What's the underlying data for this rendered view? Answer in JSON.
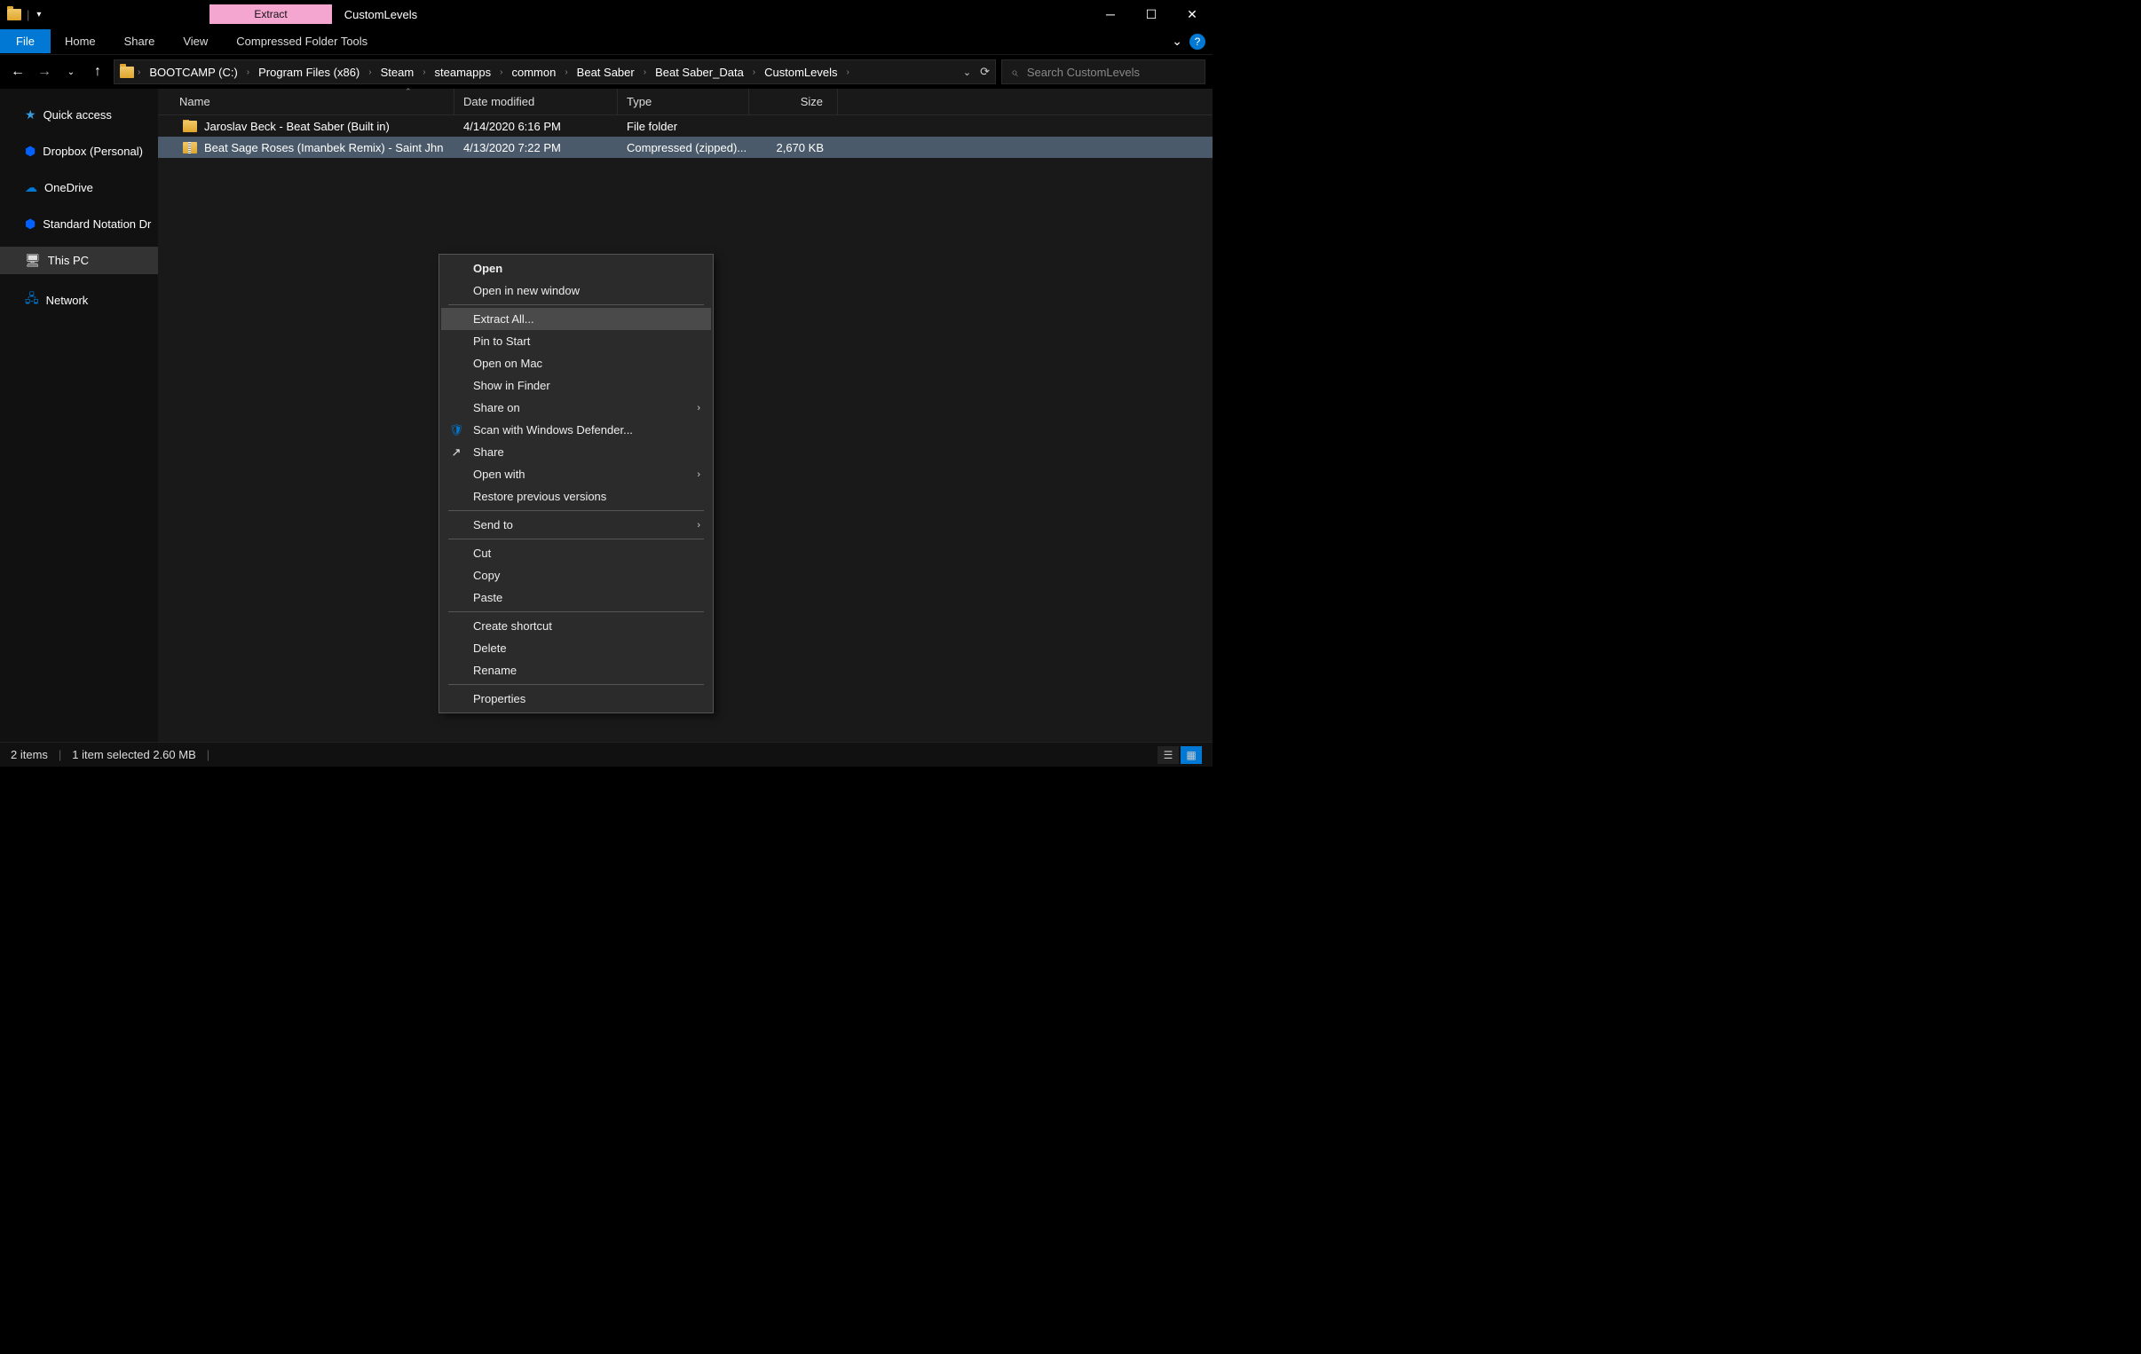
{
  "titlebar": {
    "extract_tab": "Extract",
    "title": "CustomLevels"
  },
  "ribbon": {
    "file": "File",
    "home": "Home",
    "share": "Share",
    "view": "View",
    "compressed": "Compressed Folder Tools"
  },
  "breadcrumbs": [
    "BOOTCAMP (C:)",
    "Program Files (x86)",
    "Steam",
    "steamapps",
    "common",
    "Beat Saber",
    "Beat Saber_Data",
    "CustomLevels"
  ],
  "search": {
    "placeholder": "Search CustomLevels"
  },
  "sidebar": {
    "quick_access": "Quick access",
    "dropbox": "Dropbox (Personal)",
    "onedrive": "OneDrive",
    "standard": "Standard Notation Dr",
    "this_pc": "This PC",
    "network": "Network"
  },
  "columns": {
    "name": "Name",
    "date": "Date modified",
    "type": "Type",
    "size": "Size"
  },
  "rows": [
    {
      "name": "Jaroslav Beck - Beat Saber (Built in)",
      "date": "4/14/2020 6:16 PM",
      "type": "File folder",
      "size": ""
    },
    {
      "name": "Beat Sage Roses (Imanbek Remix) - Saint Jhn",
      "date": "4/13/2020 7:22 PM",
      "type": "Compressed (zipped)...",
      "size": "2,670 KB"
    }
  ],
  "context": {
    "open": "Open",
    "open_new": "Open in new window",
    "extract_all": "Extract All...",
    "pin": "Pin to Start",
    "open_mac": "Open on Mac",
    "show_finder": "Show in Finder",
    "share_on": "Share on",
    "defender": "Scan with Windows Defender...",
    "share": "Share",
    "open_with": "Open with",
    "restore": "Restore previous versions",
    "send_to": "Send to",
    "cut": "Cut",
    "copy": "Copy",
    "paste": "Paste",
    "shortcut": "Create shortcut",
    "delete": "Delete",
    "rename": "Rename",
    "properties": "Properties"
  },
  "status": {
    "items": "2 items",
    "selected": "1 item selected  2.60 MB"
  }
}
